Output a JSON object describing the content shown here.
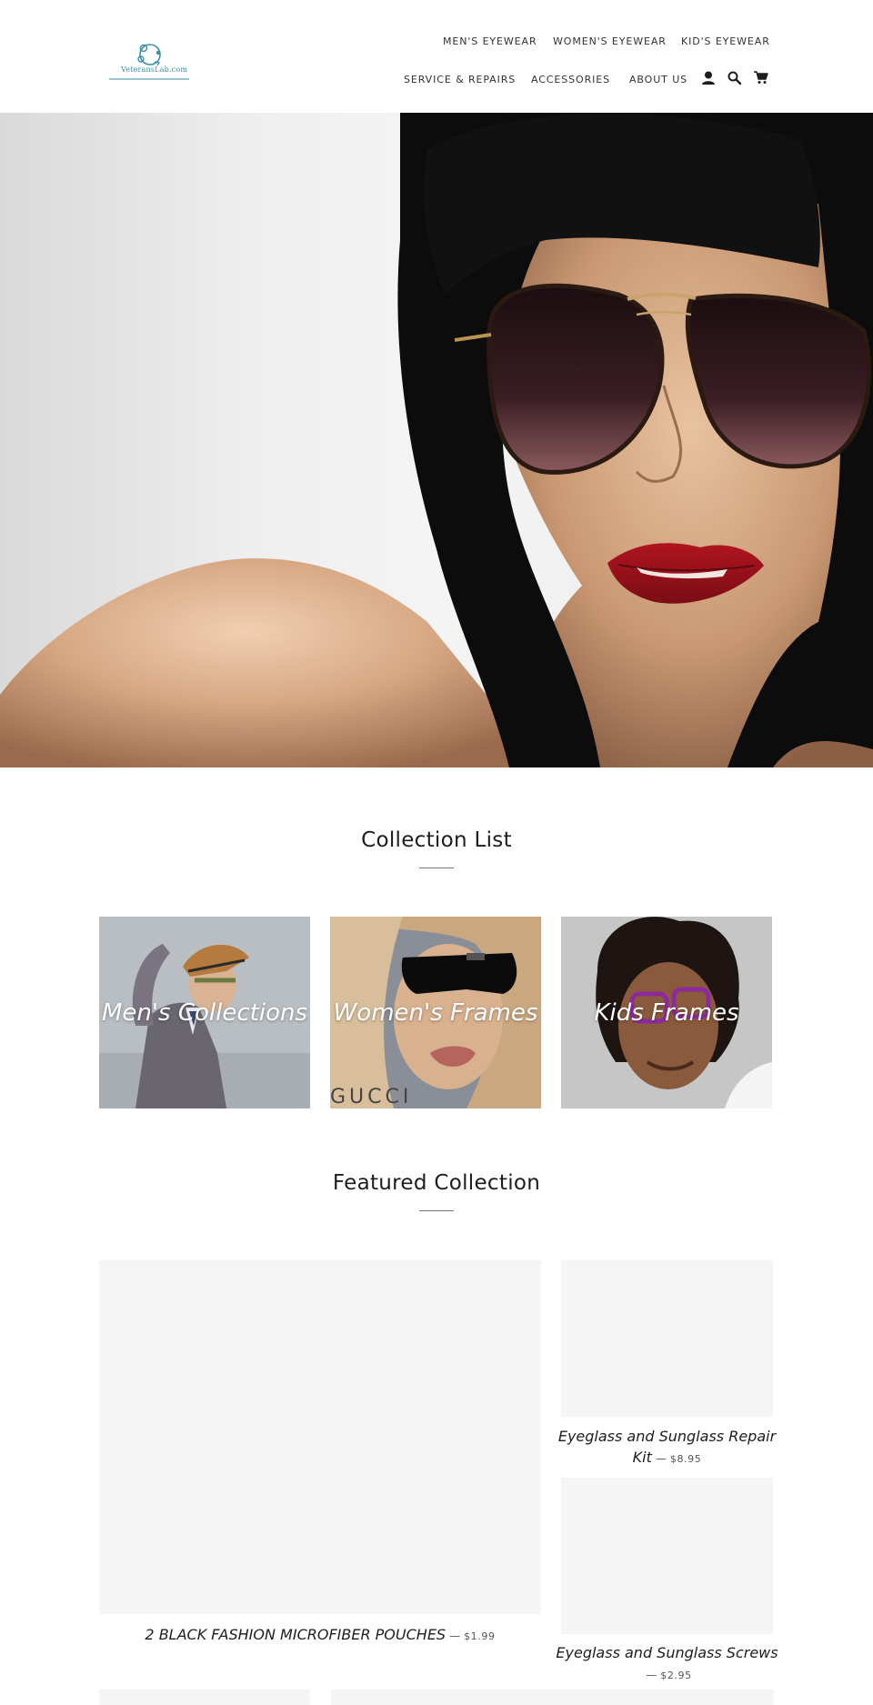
{
  "header": {
    "logo_text": "VeteransLab.com",
    "nav_top": [
      "MEN'S EYEWEAR",
      "WOMEN'S EYEWEAR",
      "KID'S EYEWEAR"
    ],
    "nav_bottom": [
      "SERVICE & REPAIRS",
      "ACCESSORIES",
      "ABOUT US"
    ],
    "icons": [
      "account-icon",
      "search-icon",
      "cart-icon"
    ]
  },
  "collection_list": {
    "title": "Collection List",
    "items": [
      {
        "label": "Men's Collections"
      },
      {
        "label": "Women's Frames"
      },
      {
        "label": "Kids Frames"
      }
    ]
  },
  "featured": {
    "title": "Featured Collection",
    "products": [
      {
        "title": "2 BLACK FASHION MICROFIBER POUCHES",
        "price": "$1.99"
      },
      {
        "title_line1": "Eyeglass and Sunglass Repair",
        "title_line2": "Kit",
        "price": "$8.95"
      },
      {
        "title": "Eyeglass and Sunglass Screws",
        "price": "$2.95"
      }
    ]
  },
  "colors": {
    "text": "#1c1d1d",
    "placeholder": "#f5f5f5",
    "logo_accent": "#3a8fa8"
  }
}
